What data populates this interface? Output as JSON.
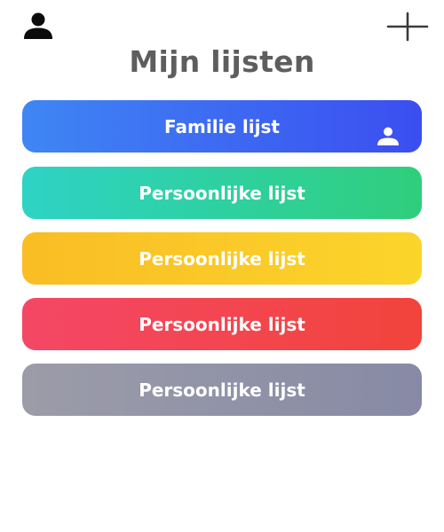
{
  "header": {
    "title": "Mijn lijsten",
    "profile_icon": "person-icon",
    "add_icon": "plus-icon"
  },
  "lists": [
    {
      "label": "Familie lijst",
      "shared_icon": "person-icon",
      "gradient": [
        "#3f86f4",
        "#3b4ef0"
      ]
    },
    {
      "label": "Persoonlijke lijst",
      "gradient": [
        "#2ed3c5",
        "#2fce7c"
      ]
    },
    {
      "label": "Persoonlijke lijst",
      "gradient": [
        "#fabd25",
        "#fbd52a"
      ]
    },
    {
      "label": "Persoonlijke lijst",
      "gradient": [
        "#f44766",
        "#f2443b"
      ]
    },
    {
      "label": "Persoonlijke lijst",
      "gradient": [
        "#9c9ca8",
        "#878aa6"
      ]
    }
  ]
}
